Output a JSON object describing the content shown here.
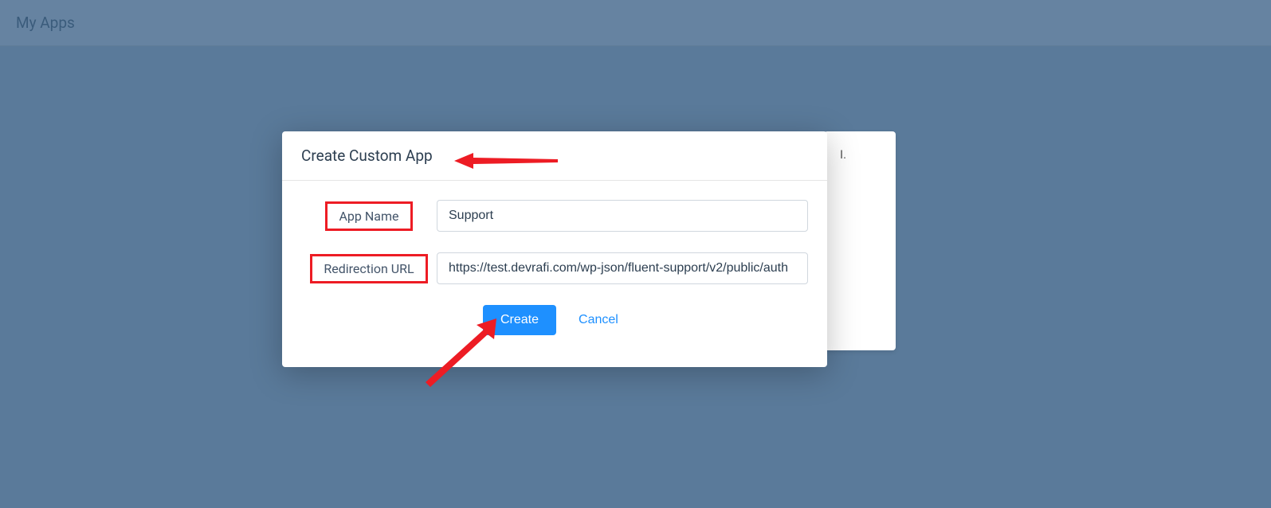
{
  "page": {
    "title": "My Apps"
  },
  "background_panel": {
    "partial_text": "I."
  },
  "modal": {
    "title": "Create Custom App",
    "fields": {
      "app_name": {
        "label": "App Name",
        "value": "Support"
      },
      "redirection_url": {
        "label": "Redirection URL",
        "value": "https://test.devrafi.com/wp-json/fluent-support/v2/public/auth"
      }
    },
    "buttons": {
      "create": "Create",
      "cancel": "Cancel"
    }
  },
  "annotations": {
    "highlight_color": "#ed1c24",
    "arrow_color": "#ed1c24"
  }
}
